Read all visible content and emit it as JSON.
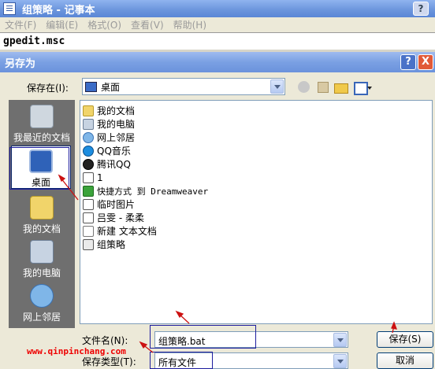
{
  "notepad": {
    "title": "组策略 - 记事本",
    "help_btn": "?",
    "menu": [
      "文件(F)",
      "编辑(E)",
      "格式(O)",
      "查看(V)",
      "帮助(H)"
    ],
    "content": "gpedit.msc"
  },
  "dialog": {
    "title": "另存为",
    "help": "?",
    "close": "X",
    "save_in_label": "保存在(I):",
    "save_in_value": "桌面",
    "places": [
      "我最近的文档",
      "桌面",
      "我的文档",
      "我的电脑",
      "网上邻居"
    ],
    "selected_place": "桌面",
    "files": [
      {
        "name": "我的文档",
        "icon": "my-documents-icon"
      },
      {
        "name": "我的电脑",
        "icon": "my-computer-icon"
      },
      {
        "name": "网上邻居",
        "icon": "network-icon"
      },
      {
        "name": "QQ音乐",
        "icon": "qqmusic-icon"
      },
      {
        "name": "腾讯QQ",
        "icon": "qq-icon"
      },
      {
        "name": "1",
        "icon": "document-icon"
      },
      {
        "name": "快捷方式 到 Dreamweaver",
        "icon": "dreamweaver-shortcut-icon"
      },
      {
        "name": "临时图片",
        "icon": "document-icon"
      },
      {
        "name": "吕雯 - 柔柔",
        "icon": "document-icon"
      },
      {
        "name": "新建 文本文档",
        "icon": "text-file-icon"
      },
      {
        "name": "组策略",
        "icon": "batch-file-icon"
      }
    ],
    "filename_label": "文件名(N):",
    "filename_value": "组策略.bat",
    "filetype_label": "保存类型(T):",
    "filetype_value": "所有文件",
    "save_button": "保存(S)",
    "cancel_button": "取消"
  },
  "watermark": "www.qinpinchang.com",
  "colors": {
    "annotation_arrow": "#cc1111",
    "annotation_box": "#1d1d9e",
    "watermark": "#ee0000"
  }
}
